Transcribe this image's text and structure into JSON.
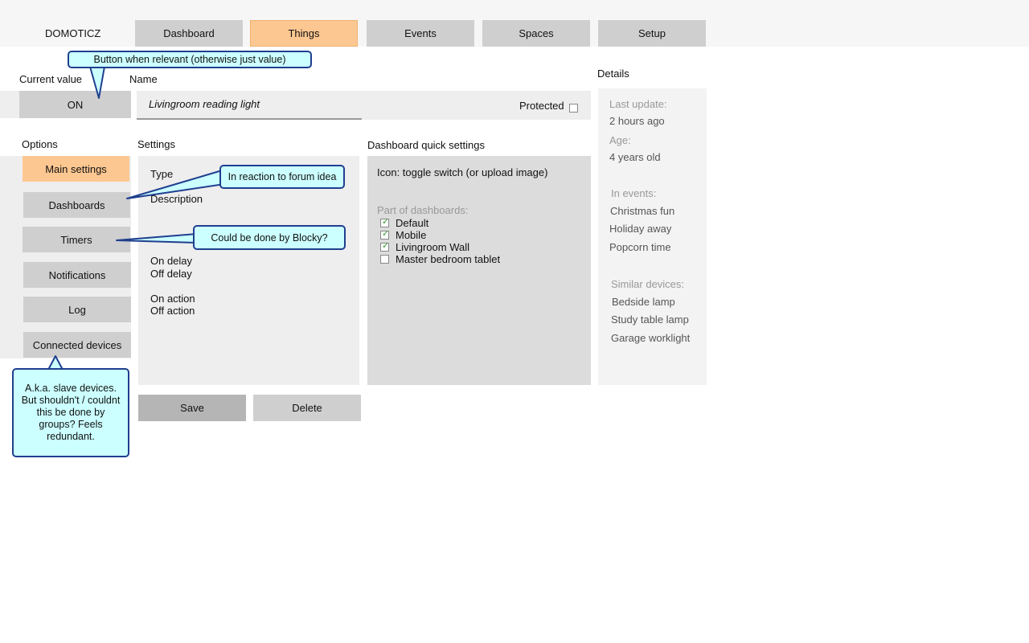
{
  "app": {
    "brand": "DOMOTICZ"
  },
  "nav": {
    "tabs": [
      {
        "label": "Dashboard"
      },
      {
        "label": "Things"
      },
      {
        "label": "Events"
      },
      {
        "label": "Spaces"
      },
      {
        "label": "Setup"
      }
    ]
  },
  "current_value": {
    "label": "Current value",
    "button": "ON"
  },
  "name": {
    "label": "Name",
    "value": "Livingroom reading light",
    "protected_label": "Protected",
    "protected": false
  },
  "options": {
    "label": "Options",
    "items": [
      "Main settings",
      "Dashboards",
      "Timers",
      "Notifications",
      "Log",
      "Connected devices"
    ]
  },
  "settings": {
    "label": "Settings",
    "type": "Type",
    "description": "Description",
    "on_delay": "On delay",
    "off_delay": "Off delay",
    "on_action": "On action",
    "off_action": "Off action"
  },
  "quick": {
    "label": "Dashboard quick settings",
    "icon_text": "Icon: toggle switch (or upload image)",
    "part_of_label": "Part of dashboards:",
    "dashboards": [
      {
        "name": "Default",
        "checked": true
      },
      {
        "name": "Mobile",
        "checked": true
      },
      {
        "name": "Livingroom Wall",
        "checked": true
      },
      {
        "name": "Master bedroom tablet",
        "checked": false
      }
    ]
  },
  "details": {
    "label": "Details",
    "last_update_label": "Last update:",
    "last_update": "2 hours ago",
    "age_label": "Age:",
    "age": "4 years old",
    "events_label": "In events:",
    "events": [
      "Christmas fun",
      "Holiday away",
      "Popcorn time"
    ],
    "similar_label": "Similar devices:",
    "similar": [
      "Bedside lamp",
      "Study table lamp",
      "Garage worklight"
    ]
  },
  "actions": {
    "save": "Save",
    "delete": "Delete"
  },
  "callouts": {
    "button_relevant": "Button when relevant (otherwise just value)",
    "forum_idea": "In reaction to forum idea",
    "blocky": "Could be done by Blocky?",
    "slave_devices": "A.k.a. slave devices. But shouldn't / couldnt this be done by groups? Feels redundant."
  },
  "colors": {
    "accent": "#fdc791",
    "callout_bg": "#ccffff",
    "callout_border": "#1f3f8f"
  }
}
